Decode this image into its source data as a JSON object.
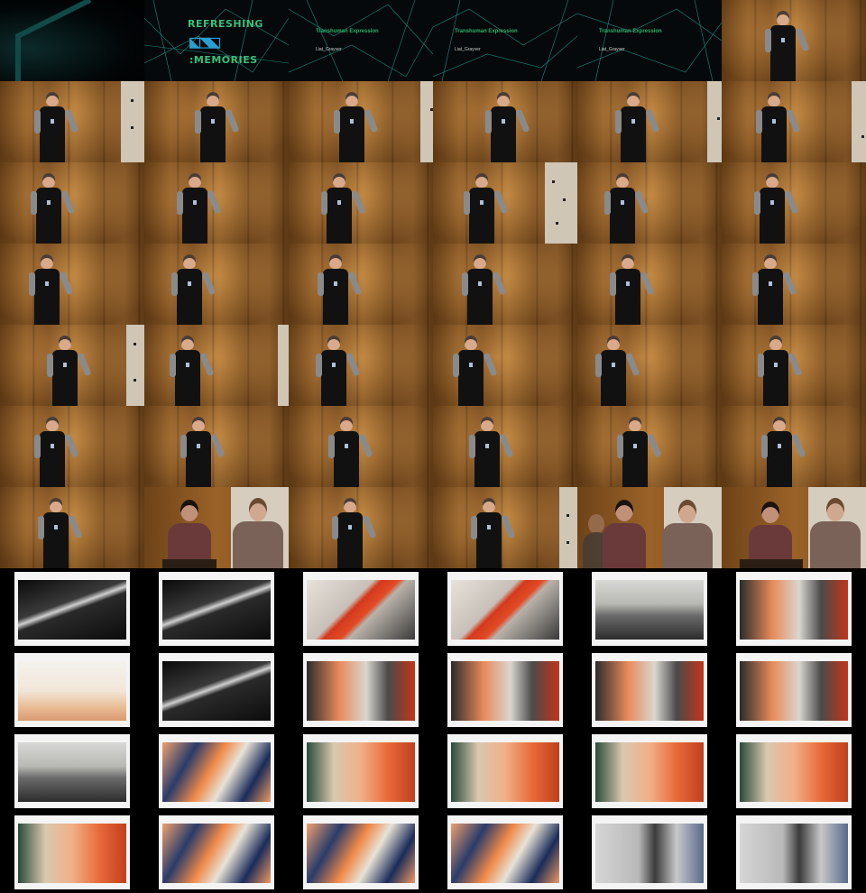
{
  "title_card": {
    "logo_line1": "REFRESHING",
    "logo_glyphs": "⬕⬔⬕",
    "logo_line2": ":MEMORIES"
  },
  "talk_cards": [
    {
      "title": "Transhuman Expression",
      "author": "Liat_Grayver"
    },
    {
      "title": "Transhuman Expression",
      "author": "Liat_Grayver"
    },
    {
      "title": "Transhuman Expression",
      "author": "Liat_Grayver"
    }
  ],
  "icons": {
    "speaker": "person-figure",
    "machine": "robot-arm",
    "painting": "abstract-painting"
  }
}
